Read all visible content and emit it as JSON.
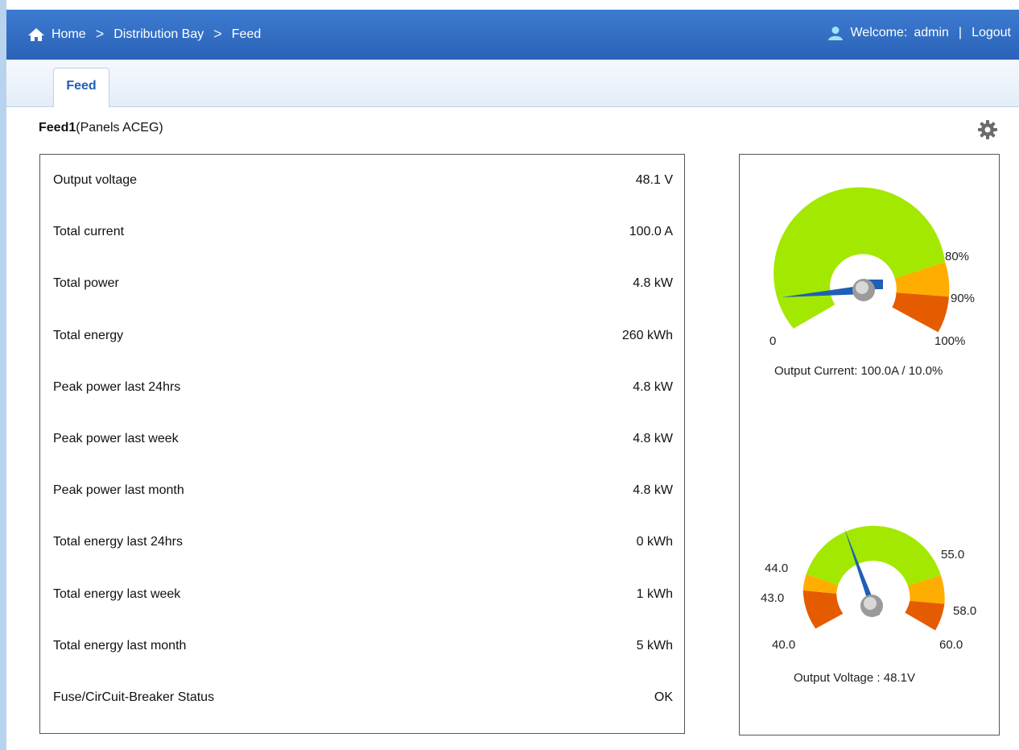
{
  "breadcrumb": {
    "items": [
      "Home",
      "Distribution Bay",
      "Feed"
    ],
    "separator": ">"
  },
  "user": {
    "welcome_label": "Welcome:",
    "username": "admin",
    "separator": "|",
    "logout_label": "Logout"
  },
  "tabs": [
    {
      "label": "Feed",
      "active": true
    }
  ],
  "feed": {
    "name": "Feed1",
    "panels": "(Panels ACEG)"
  },
  "metrics": [
    {
      "label": "Output voltage",
      "value": "48.1 V"
    },
    {
      "label": "Total current",
      "value": "100.0 A"
    },
    {
      "label": "Total power",
      "value": "4.8 kW"
    },
    {
      "label": "Total energy",
      "value": "260 kWh"
    },
    {
      "label": "Peak power last 24hrs",
      "value": "4.8 kW"
    },
    {
      "label": "Peak power last week",
      "value": "4.8 kW"
    },
    {
      "label": "Peak power last month",
      "value": "4.8 kW"
    },
    {
      "label": "Total energy last 24hrs",
      "value": "0 kWh"
    },
    {
      "label": "Total energy last week",
      "value": "1 kWh"
    },
    {
      "label": "Total energy last month",
      "value": "5 kWh"
    },
    {
      "label": "Fuse/CirCuit-Breaker Status",
      "value": "OK"
    }
  ],
  "gauges": {
    "current": {
      "caption": "Output Current: 100.0A  / 10.0%",
      "value_percent": 10.0,
      "labels": {
        "min": "0",
        "warn": "80%",
        "alarm": "90%",
        "max": "100%"
      }
    },
    "voltage": {
      "caption": "Output Voltage : 48.1V",
      "value": 48.1,
      "labels": {
        "min": "40.0",
        "low_alarm": "43.0",
        "low_warn": "44.0",
        "high_warn": "55.0",
        "high_alarm": "58.0",
        "max": "60.0"
      }
    }
  },
  "colors": {
    "header": "#2f6cc0",
    "tab_text": "#1f5fb5",
    "gauge_ok": "#a3e800",
    "gauge_warn": "#ffad00",
    "gauge_alarm": "#e55b00",
    "needle": "#1f5fb5"
  },
  "icons": [
    "home-icon",
    "user-icon",
    "gear-icon"
  ]
}
